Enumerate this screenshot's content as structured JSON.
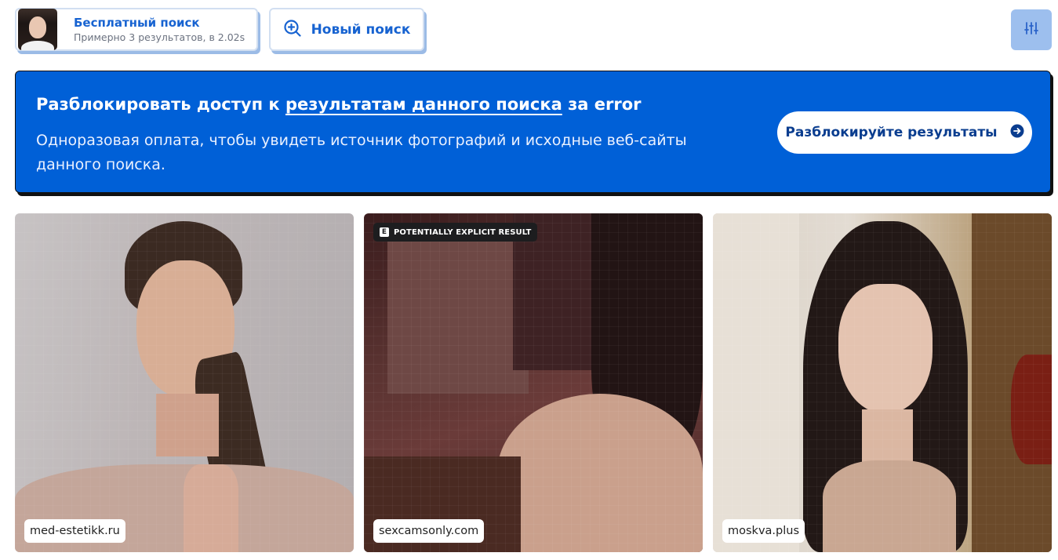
{
  "search": {
    "title": "Бесплатный поиск",
    "subtitle": "Примерно 3 результатов, в 2.02s"
  },
  "toolbar": {
    "new_search_label": "Новый поиск"
  },
  "banner": {
    "title_prefix": "Разблокировать доступ к ",
    "title_link": "результатам данного поиска",
    "title_suffix": " за error",
    "description": "Одноразовая оплата, чтобы увидеть источник фотографий и исходные веб-сайты данного поиска.",
    "button_label": "Разблокируйте результаты"
  },
  "results": [
    {
      "source": "med-estetikk.ru",
      "explicit": false
    },
    {
      "source": "sexcamsonly.com",
      "explicit": true,
      "badge_letter": "E",
      "badge_text": "POTENTIALLY EXPLICIT RESULT"
    },
    {
      "source": "moskva.plus",
      "explicit": false
    }
  ],
  "colors": {
    "accent": "#1763d1",
    "banner_bg": "#0060d7",
    "filter_button": "#9dbfee"
  },
  "icons": {
    "new_search": "zoom-plus-icon",
    "filter": "sliders-icon",
    "unlock_arrow": "arrow-circle-right-icon"
  }
}
